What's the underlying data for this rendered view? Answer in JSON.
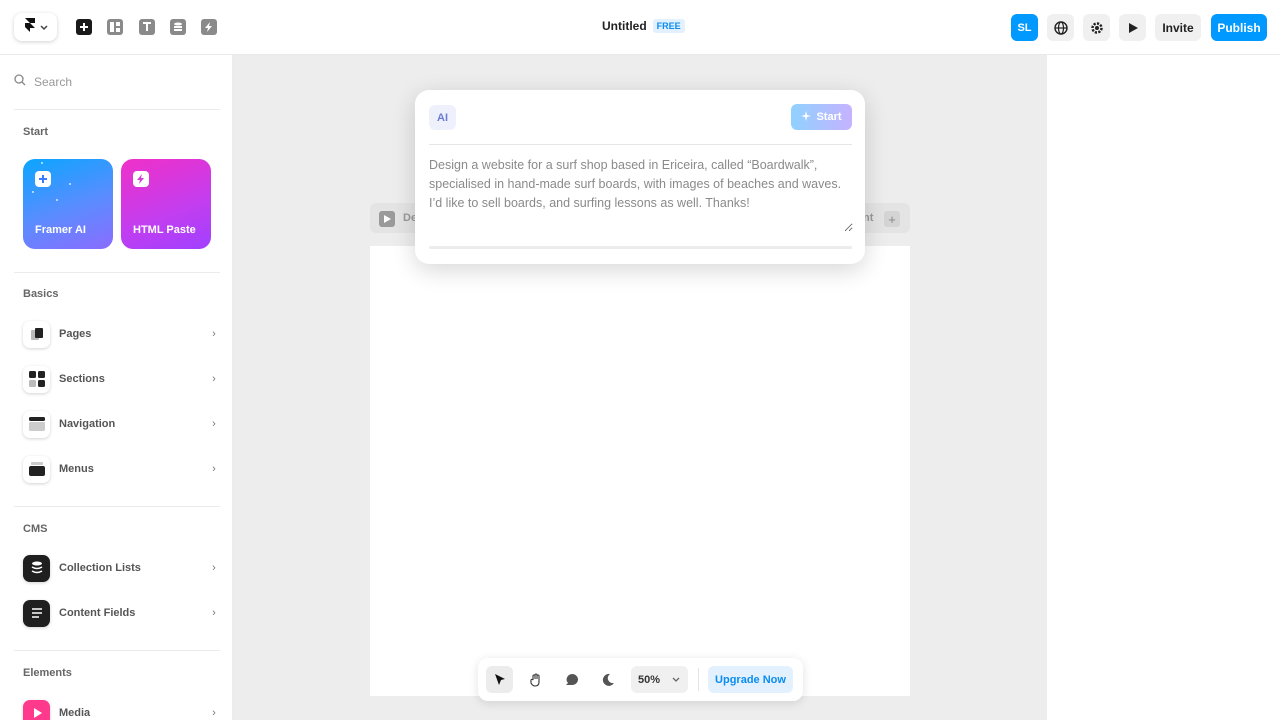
{
  "app": {
    "title": "Untitled",
    "plan_badge": "FREE",
    "avatar_initials": "SL",
    "invite_label": "Invite",
    "publish_label": "Publish",
    "accent_color": "#0099ff"
  },
  "toolbar_icons": [
    "framer-logo-icon",
    "insert-icon",
    "layout-icon",
    "text-icon",
    "cms-icon",
    "assets-icon"
  ],
  "topbar_right_icons": [
    "globe-icon",
    "gear-icon",
    "play-icon"
  ],
  "sidebar": {
    "search_placeholder": "Search",
    "start": {
      "label": "Start",
      "cards": [
        {
          "label": "Framer AI",
          "icon": "plus-icon"
        },
        {
          "label": "HTML Paste",
          "icon": "bolt-icon"
        }
      ]
    },
    "basics": {
      "label": "Basics",
      "items": [
        {
          "label": "Pages",
          "icon": "pages-icon"
        },
        {
          "label": "Sections",
          "icon": "sections-icon"
        },
        {
          "label": "Navigation",
          "icon": "navigation-icon"
        },
        {
          "label": "Menus",
          "icon": "menus-icon"
        }
      ]
    },
    "cms": {
      "label": "CMS",
      "items": [
        {
          "label": "Collection Lists",
          "icon": "database-icon"
        },
        {
          "label": "Content Fields",
          "icon": "lines-icon"
        }
      ]
    },
    "elements": {
      "label": "Elements",
      "items": [
        {
          "label": "Media",
          "icon": "media-icon"
        }
      ]
    }
  },
  "canvas": {
    "frame_label_left": "De",
    "frame_label_right": "nt"
  },
  "ai_dialog": {
    "logo_text": "AI",
    "start_label": "Start",
    "prompt_placeholder": "Design a website for a surf shop based in Ericeira, called “Boardwalk”, specialised in hand-made surf boards, with images of beaches and waves. I’d like to sell boards, and surfing lessons as well. Thanks!"
  },
  "bottom_toolbar": {
    "zoom": "50%",
    "upgrade_label": "Upgrade Now",
    "tools": [
      "pointer-icon",
      "hand-icon",
      "comment-icon",
      "moon-icon"
    ]
  }
}
